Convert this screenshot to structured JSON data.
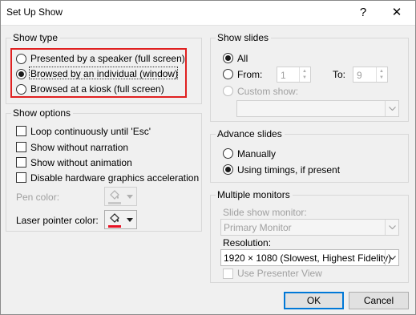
{
  "window": {
    "title": "Set Up Show",
    "help_glyph": "?",
    "close_glyph": "✕"
  },
  "show_type": {
    "legend": "Show type",
    "options": [
      {
        "label": "Presented by a speaker (full screen)",
        "checked": false
      },
      {
        "label": "Browsed by an individual (window)",
        "checked": true
      },
      {
        "label": "Browsed at a kiosk (full screen)",
        "checked": false
      }
    ]
  },
  "show_options": {
    "legend": "Show options",
    "checkboxes": [
      {
        "label": "Loop continuously until 'Esc'",
        "checked": false,
        "enabled": true
      },
      {
        "label": "Show without narration",
        "checked": false,
        "enabled": true
      },
      {
        "label": "Show without animation",
        "checked": false,
        "enabled": true
      },
      {
        "label": "Disable hardware graphics acceleration",
        "checked": false,
        "enabled": true
      }
    ],
    "pen_color_label": "Pen color:",
    "laser_pointer_color_label": "Laser pointer color:",
    "pen_color": "#c8c8c8",
    "laser_color": "#e81123"
  },
  "show_slides": {
    "legend": "Show slides",
    "all_label": "All",
    "from_label": "From:",
    "from_value": "1",
    "to_label": "To:",
    "to_value": "9",
    "custom_show_label": "Custom show:",
    "custom_show_value": "",
    "selected": "all"
  },
  "advance_slides": {
    "legend": "Advance slides",
    "options": [
      {
        "label": "Manually",
        "checked": false
      },
      {
        "label": "Using timings, if present",
        "checked": true
      }
    ]
  },
  "multiple_monitors": {
    "legend": "Multiple monitors",
    "slide_show_monitor_label": "Slide show monitor:",
    "slide_show_monitor_value": "Primary Monitor",
    "resolution_label": "Resolution:",
    "resolution_value": "1920 × 1080 (Slowest, Highest Fidelity)",
    "presenter_view_label": "Use Presenter View",
    "presenter_view_checked": false
  },
  "buttons": {
    "ok": "OK",
    "cancel": "Cancel"
  },
  "colors": {
    "highlight": "#e02020",
    "default_button_border": "#0078d7"
  }
}
